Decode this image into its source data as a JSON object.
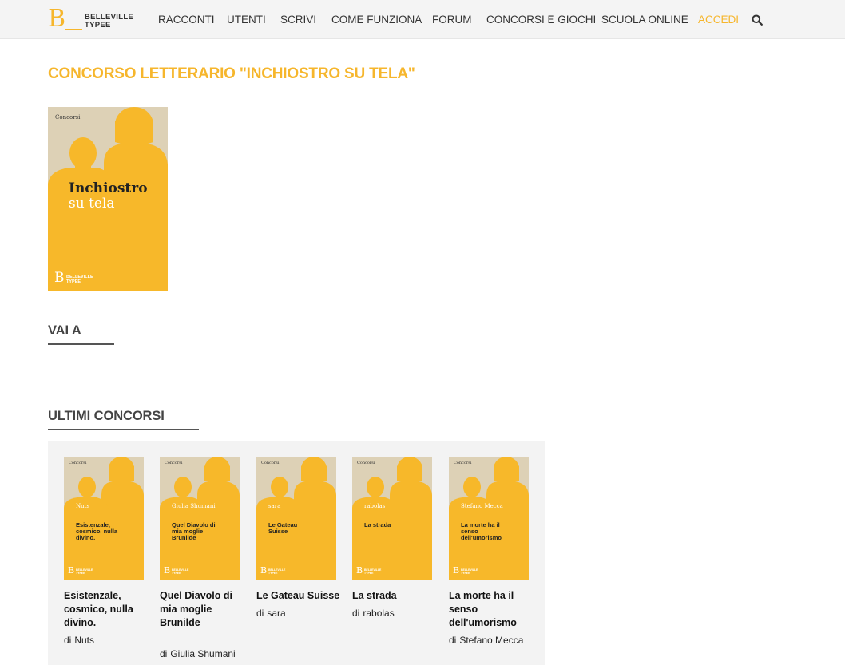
{
  "brand": {
    "logo_letter": "B",
    "line1": "BELLEVILLE",
    "line2": "TYPEE"
  },
  "nav": {
    "items": [
      "RACCONTI",
      "UTENTI",
      "SCRIVI",
      "COME FUNZIONA",
      "FORUM",
      "CONCORSI E GIOCHI",
      "SCUOLA ONLINE"
    ],
    "login": "ACCEDI",
    "search_icon": "search-icon"
  },
  "page": {
    "title": "CONCORSO LETTERARIO \"INCHIOSTRO SU TELA\""
  },
  "poster": {
    "label": "Concorsi",
    "title": "Inchiostro",
    "subtitle": "su tela",
    "logo_letter": "B",
    "logo_line1": "BELLEVILLE",
    "logo_line2": "TYPEE"
  },
  "sections": {
    "vai_a": "VAI A",
    "ultimi_concorsi": "ULTIMI CONCORSI"
  },
  "contests": [
    {
      "thumb_label": "Concorsi",
      "thumb_author": "Nuts",
      "thumb_title": "Esistenzale, cosmico, nulla divino.",
      "title": "Esistenzale, cosmico, nulla divino.",
      "by": "di",
      "author": "Nuts"
    },
    {
      "thumb_label": "Concorsi",
      "thumb_author": "Giulia Shumani",
      "thumb_title": "Quel Diavolo di mia moglie Brunilde",
      "title": "Quel Diavolo di mia moglie Brunilde",
      "by": "di",
      "author": "Giulia Shumani"
    },
    {
      "thumb_label": "Concorsi",
      "thumb_author": "sara",
      "thumb_title": "Le Gateau Suisse",
      "title": "Le Gateau Suisse",
      "by": "di",
      "author": "sara"
    },
    {
      "thumb_label": "Concorsi",
      "thumb_author": "rabolas",
      "thumb_title": "La strada",
      "title": "La strada",
      "by": "di",
      "author": "rabolas"
    },
    {
      "thumb_label": "Concorsi",
      "thumb_author": "Stefano Mecca",
      "thumb_title": "La morte ha il senso dell'umorismo",
      "title": "La morte ha il senso dell'umorismo",
      "by": "di",
      "author": "Stefano Mecca"
    }
  ],
  "colors": {
    "accent": "#f6b62c",
    "poster_bg": "#ddd1b6",
    "panel_bg": "#f3f3f3"
  }
}
